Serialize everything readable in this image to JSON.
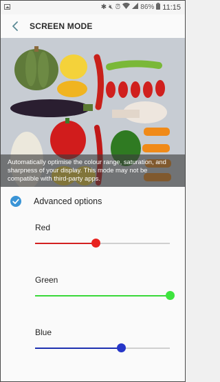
{
  "status_bar": {
    "battery": "86%",
    "time": "11:15",
    "icons": [
      "gallery-icon",
      "bluetooth-icon",
      "mute-icon",
      "alarm-icon",
      "wifi-icon",
      "signal-icon",
      "battery-icon"
    ]
  },
  "header": {
    "title": "SCREEN MODE",
    "back_icon": "back-arrow-icon"
  },
  "preview": {
    "caption": "Automatically optimise the colour range, saturation, and sharpness of your display. This mode may not be compatible with third-party apps."
  },
  "advanced": {
    "label": "Advanced options",
    "checked": true,
    "checkbox_color": "#3a94d6"
  },
  "sliders": [
    {
      "label": "Red",
      "value": 0.45,
      "color": "#d32020",
      "thumb_color": "#e8231f"
    },
    {
      "label": "Green",
      "value": 1.0,
      "color": "#38d838",
      "thumb_color": "#3ee43e"
    },
    {
      "label": "Blue",
      "value": 0.64,
      "color": "#1c2fb0",
      "thumb_color": "#2636c8"
    }
  ]
}
